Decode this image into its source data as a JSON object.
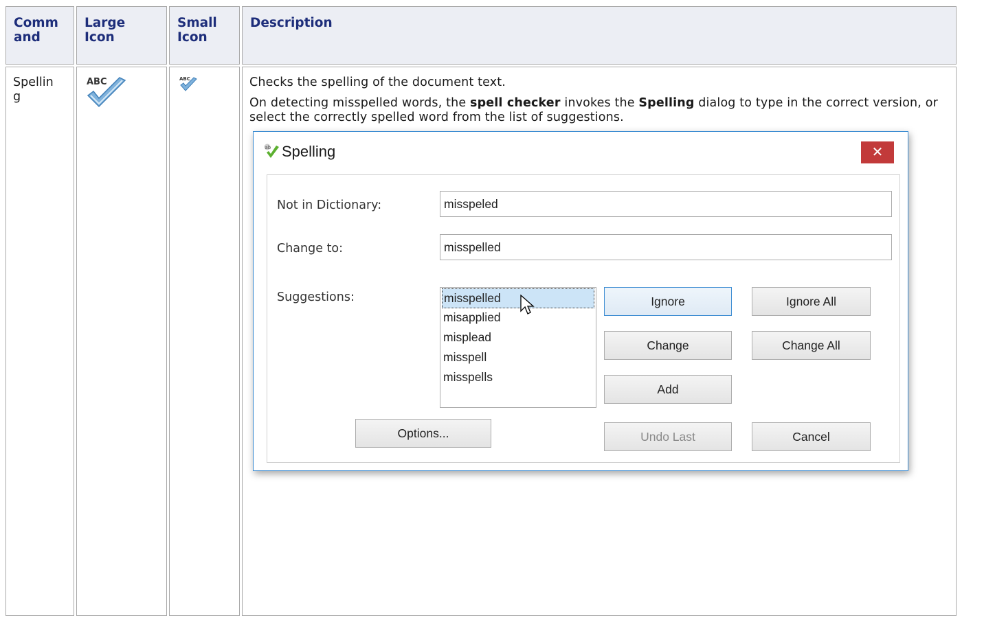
{
  "table": {
    "headers": {
      "command": "Comm and",
      "large_icon": "Large Icon",
      "small_icon": "Small Icon",
      "description": "Description"
    },
    "row": {
      "command": "Spelling",
      "large_icon": "spell-check-large-icon",
      "small_icon": "spell-check-small-icon",
      "description": {
        "line1": "Checks the spelling of the document text.",
        "line2_prefix": "On detecting misspelled words, the ",
        "line2_bold1": "spell checker",
        "line2_mid": " invokes the ",
        "line2_bold2": "Spelling",
        "line2_suffix": " dialog to type in the correct version, or select the correctly spelled word from the list of suggestions."
      }
    }
  },
  "icon_text": {
    "large": "ABC",
    "small": "ABC"
  },
  "dialog": {
    "title": "Spelling",
    "close_glyph": "✕",
    "not_in_dictionary_label": "Not in Dictionary:",
    "not_in_dictionary_value": "misspeled",
    "change_to_label": "Change to:",
    "change_to_value": "misspelled",
    "suggestions_label": "Suggestions:",
    "suggestions": [
      "misspelled",
      "misapplied",
      "misplead",
      "misspell",
      "misspells"
    ],
    "buttons": {
      "ignore": "Ignore",
      "ignore_all": "Ignore All",
      "change": "Change",
      "change_all": "Change All",
      "add": "Add",
      "options": "Options...",
      "undo_last": "Undo Last",
      "cancel": "Cancel"
    }
  },
  "colors": {
    "header_text": "#1d2d7a",
    "header_bg": "#eceef4",
    "close_button": "#c23a3a",
    "dialog_border": "#3c8cd2",
    "selection": "#cce4f7"
  }
}
